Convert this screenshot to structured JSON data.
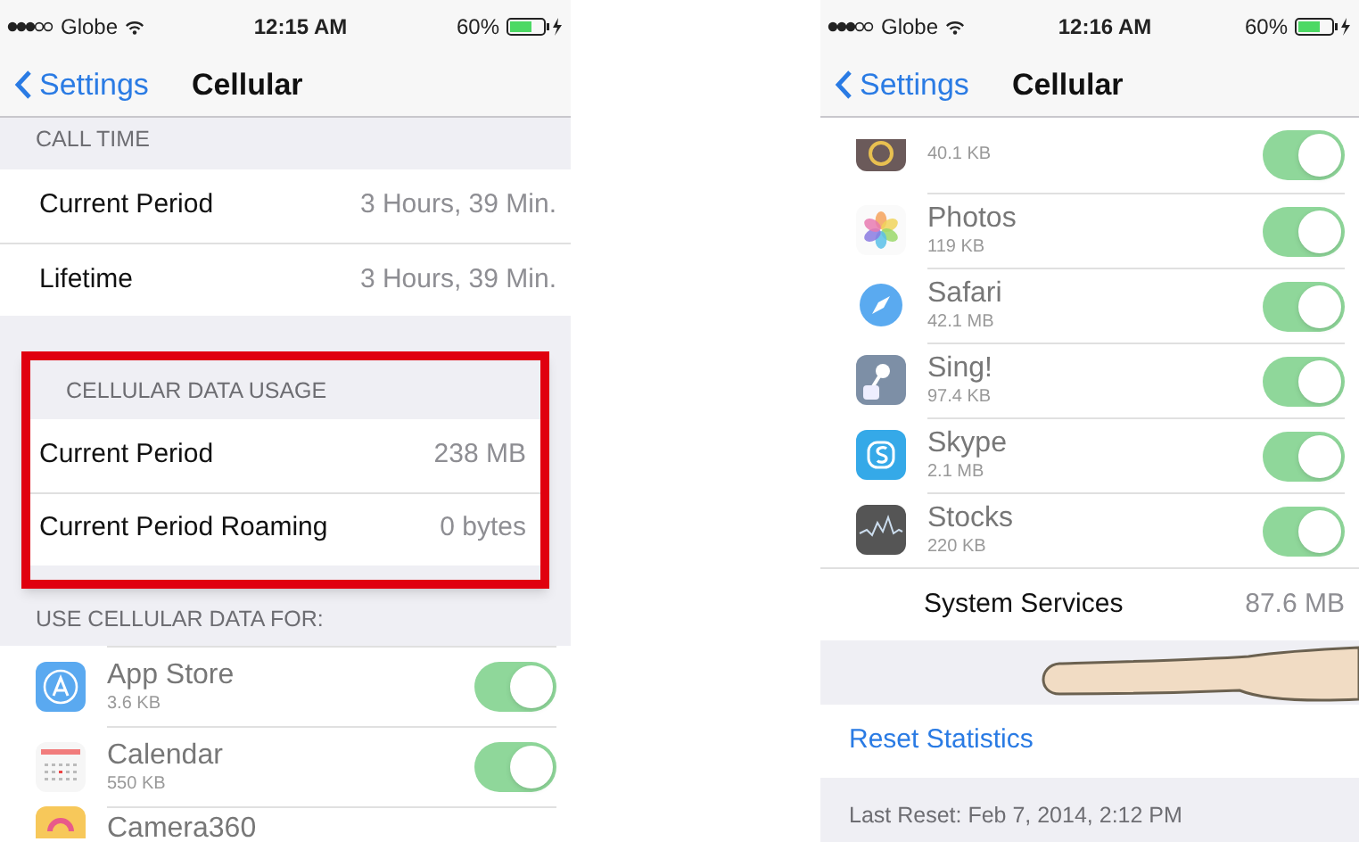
{
  "screens": [
    {
      "status_bar": {
        "carrier": "Globe",
        "time": "12:15 AM",
        "battery": "60%"
      },
      "nav": {
        "back": "Settings",
        "title": "Cellular"
      },
      "sections": [
        {
          "header": "CALL TIME",
          "highlighted": false,
          "rows": [
            {
              "kind": "value",
              "label": "Current Period",
              "value": "3 Hours, 39 Min."
            },
            {
              "kind": "value",
              "label": "Lifetime",
              "value": "3 Hours, 39 Min."
            }
          ]
        },
        {
          "header": "CELLULAR DATA USAGE",
          "highlighted": true,
          "rows": [
            {
              "kind": "value",
              "label": "Current Period",
              "value": "238 MB"
            },
            {
              "kind": "value",
              "label": "Current Period Roaming",
              "value": "0 bytes"
            }
          ]
        },
        {
          "header": "USE CELLULAR DATA FOR:",
          "highlighted": false,
          "rows": [
            {
              "kind": "app",
              "label": "App Store",
              "detail": "3.6 KB",
              "on": true
            },
            {
              "kind": "app",
              "label": "Calendar",
              "detail": "550 KB",
              "on": true
            },
            {
              "kind": "app",
              "label": "Camera360"
            }
          ]
        }
      ]
    },
    {
      "status_bar": {
        "carrier": "Globe",
        "time": "12:16 AM",
        "battery": "60%"
      },
      "nav": {
        "back": "Settings",
        "title": "Cellular"
      },
      "sections": [
        {
          "highlighted": false,
          "rows": [
            {
              "kind": "app",
              "detail": "40.1 KB",
              "on": true
            },
            {
              "kind": "app",
              "label": "Photos",
              "detail": "119 KB",
              "on": true
            },
            {
              "kind": "app",
              "label": "Safari",
              "detail": "42.1 MB",
              "on": true
            },
            {
              "kind": "app",
              "label": "Sing!",
              "detail": "97.4 KB",
              "on": true
            },
            {
              "kind": "app",
              "label": "Skype",
              "detail": "2.1 MB",
              "on": true
            },
            {
              "kind": "app",
              "label": "Stocks",
              "detail": "220 KB",
              "on": true
            },
            {
              "kind": "value",
              "label": "System Services",
              "value": "87.6 MB"
            }
          ]
        },
        {
          "highlighted": false,
          "rows": [
            {
              "kind": "link",
              "label": "Reset Statistics"
            }
          ],
          "footer": "Last Reset: Feb 7, 2014, 2:12 PM"
        }
      ]
    }
  ]
}
